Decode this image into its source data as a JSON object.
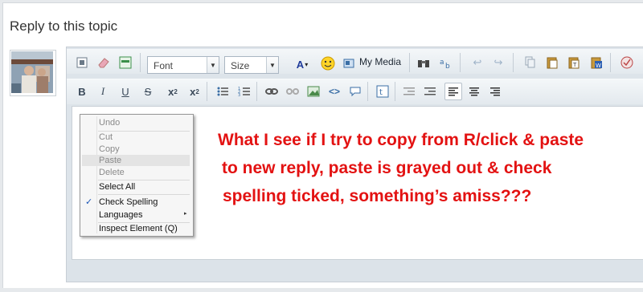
{
  "page": {
    "title": "Reply to this topic"
  },
  "toolbar_row1": {
    "font_label": "Font",
    "size_label": "Size",
    "my_media_label": "My Media"
  },
  "context_menu": {
    "items": [
      {
        "label": "Undo",
        "enabled": false
      },
      {
        "label": "Cut",
        "enabled": false
      },
      {
        "label": "Copy",
        "enabled": false
      },
      {
        "label": "Paste",
        "enabled": false
      },
      {
        "label": "Delete",
        "enabled": false
      },
      {
        "label": "Select All",
        "enabled": true
      },
      {
        "label": "Check Spelling",
        "enabled": true,
        "checked": true
      },
      {
        "label": "Languages",
        "enabled": true,
        "submenu": true
      },
      {
        "label": "Inspect Element (Q)",
        "enabled": true
      }
    ]
  },
  "annotation": {
    "lines": [
      "What I see if I try to copy from R/click & paste",
      "to new reply, paste is grayed out & check",
      "spelling ticked, something’s amiss???"
    ],
    "color": "#e31212"
  }
}
